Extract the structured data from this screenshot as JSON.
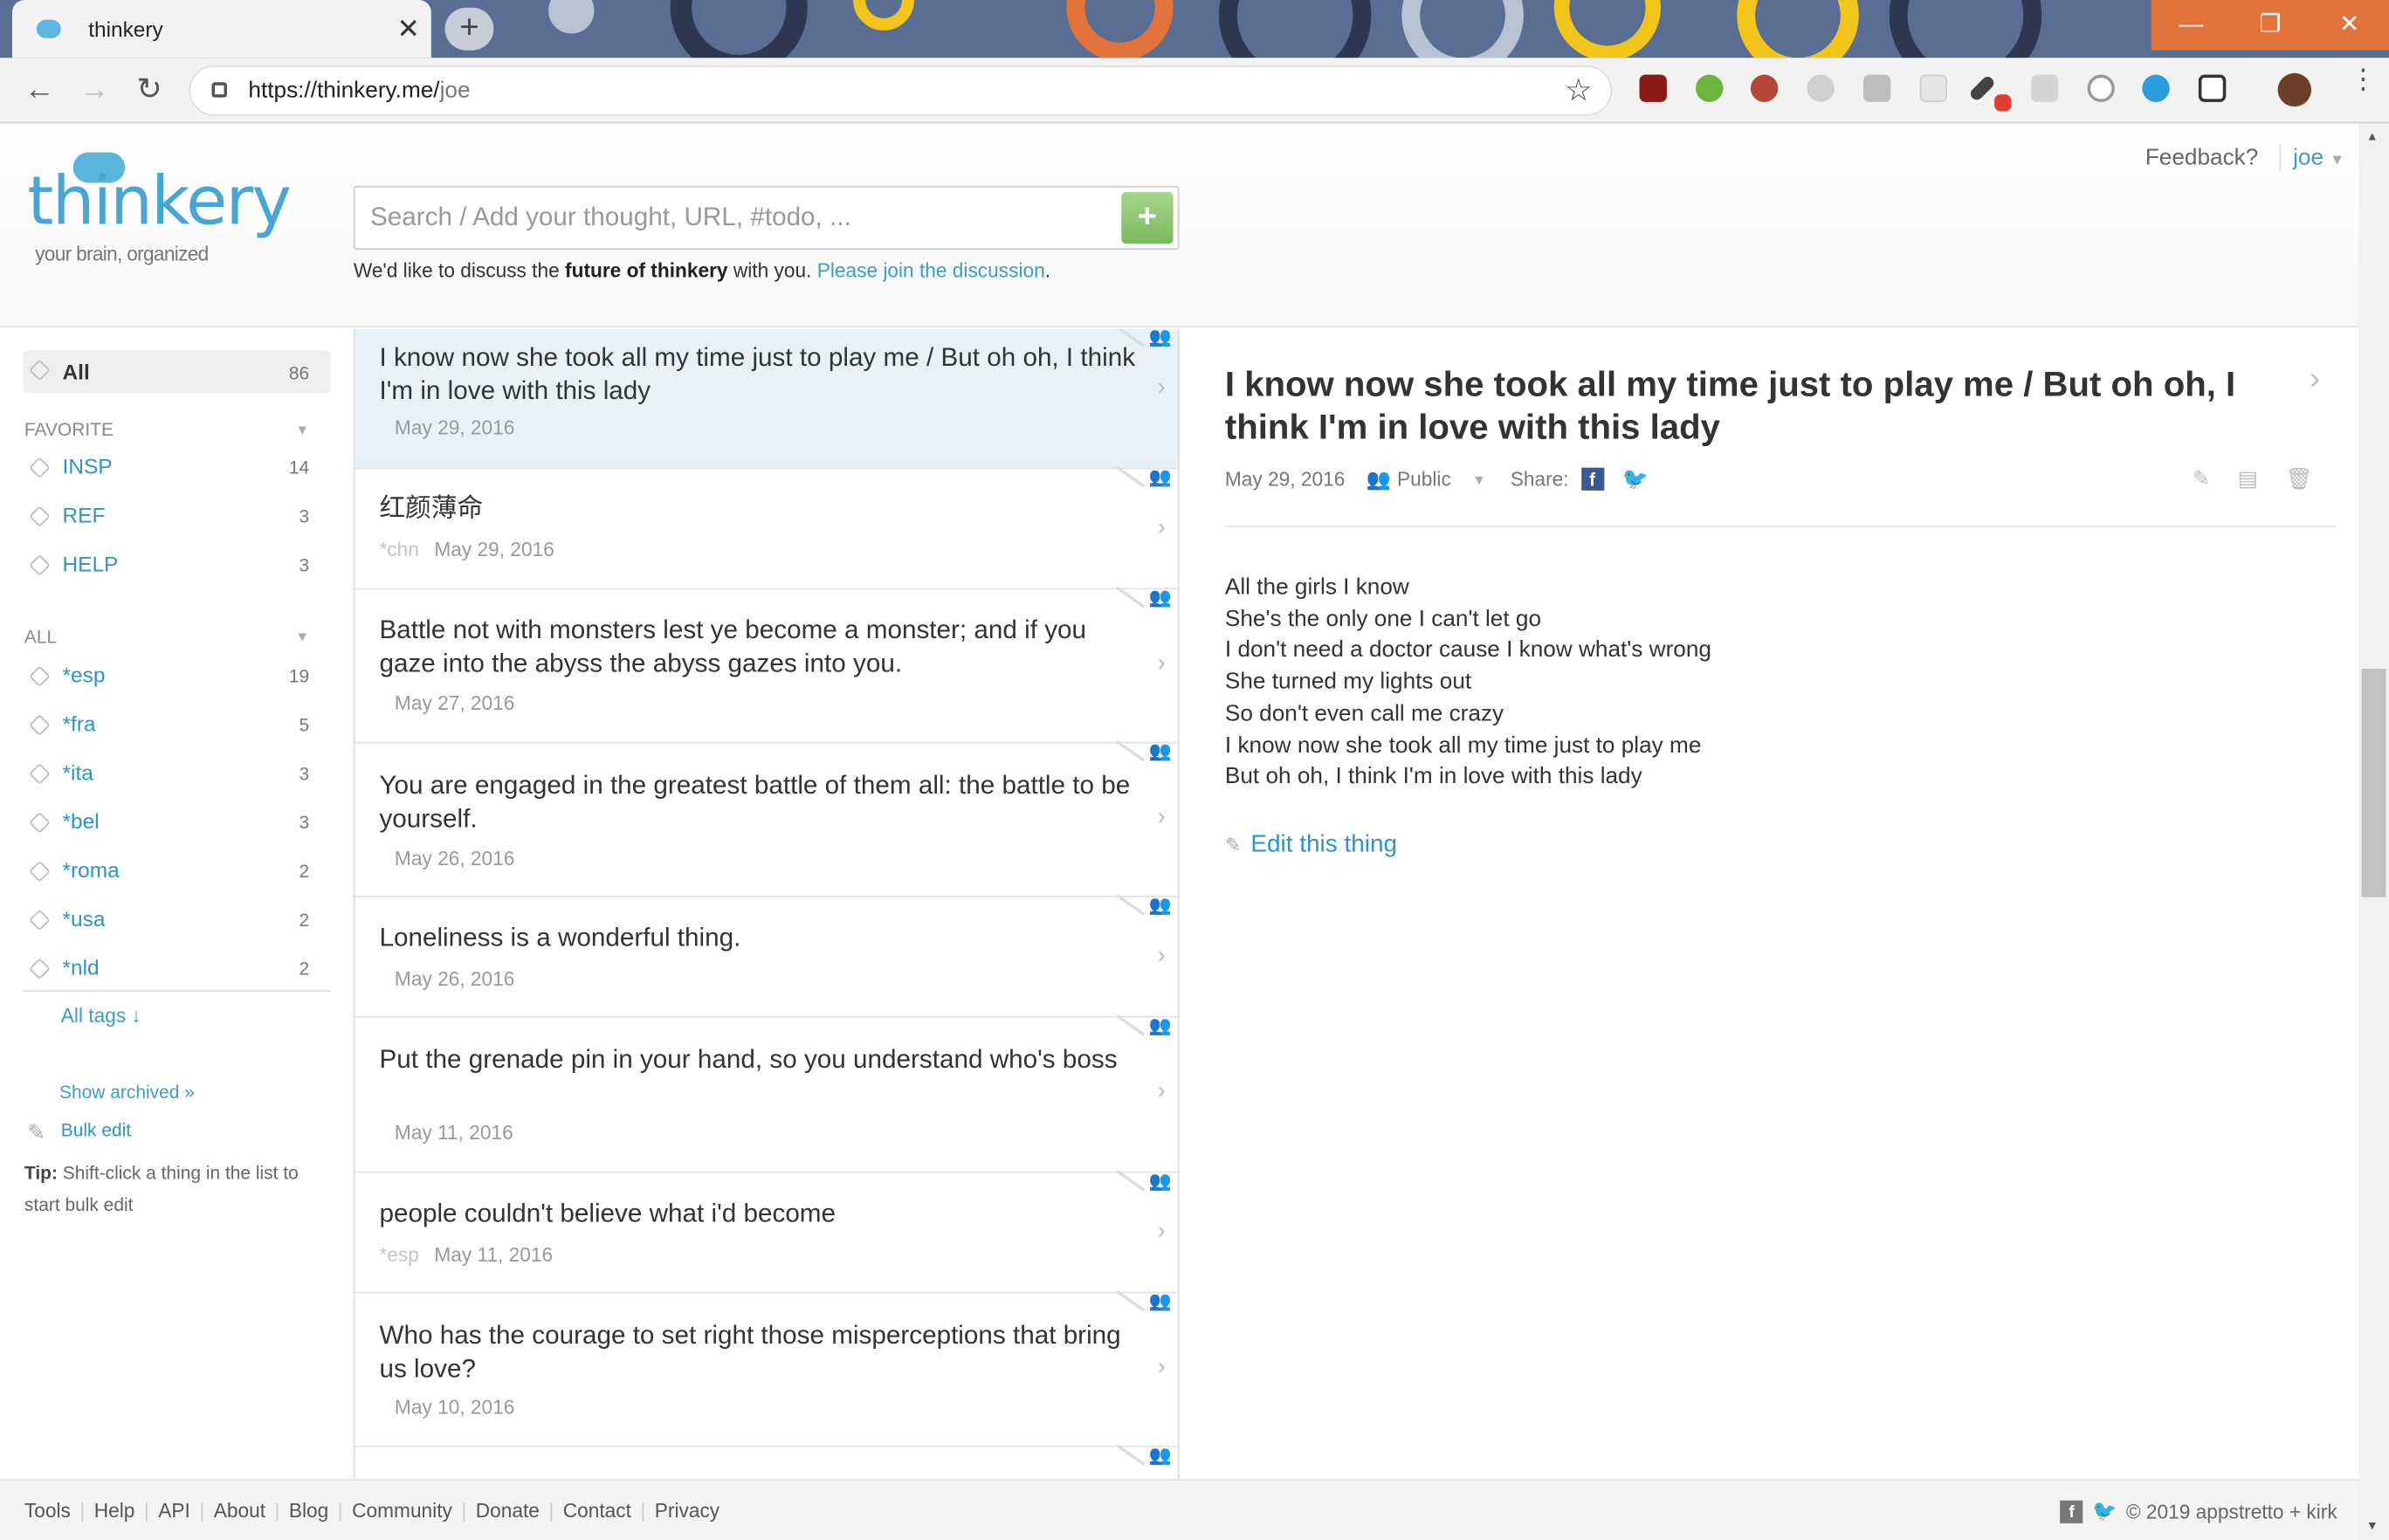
{
  "browser": {
    "tab_title": "thinkery",
    "tab_close": "✕",
    "new_tab": "+",
    "url_host": "https://thinkery.me/",
    "url_path": "joe",
    "window_controls": [
      "—",
      "❐",
      "✕"
    ]
  },
  "header": {
    "logo_word": "thinkery",
    "logo_tagline": "your brain, organized",
    "search_placeholder": "Search / Add your thought, URL, #todo, ...",
    "notice_pre": "We'd like to discuss the ",
    "notice_bold": "future of thinkery",
    "notice_mid": " with you. ",
    "notice_link": "Please join the discussion",
    "notice_end": ".",
    "feedback": "Feedback?",
    "user": "joe"
  },
  "sidebar": {
    "all": {
      "label": "All",
      "count": "86"
    },
    "favorite_heading": "FAVORITE",
    "favorites": [
      {
        "label": "INSP",
        "count": "14"
      },
      {
        "label": "REF",
        "count": "3"
      },
      {
        "label": "HELP",
        "count": "3"
      }
    ],
    "all_heading": "ALL",
    "tags": [
      {
        "label": "*esp",
        "count": "19"
      },
      {
        "label": "*fra",
        "count": "5"
      },
      {
        "label": "*ita",
        "count": "3"
      },
      {
        "label": "*bel",
        "count": "3"
      },
      {
        "label": "*roma",
        "count": "2"
      },
      {
        "label": "*usa",
        "count": "2"
      },
      {
        "label": "*nld",
        "count": "2"
      }
    ],
    "all_tags": "All tags ↓",
    "show_archived": "Show archived »",
    "bulk_edit": "Bulk edit",
    "tip_label": "Tip:",
    "tip_text": " Shift-click a thing in the list to start bulk edit"
  },
  "list": [
    {
      "title": "I know now she took all my time just to play me / But oh oh, I think I'm in love with this lady",
      "tag": "",
      "date": "May 29, 2016"
    },
    {
      "title": "红颜薄命",
      "tag": "*chn",
      "date": "May 29, 2016"
    },
    {
      "title": "Battle not with monsters lest ye become a monster; and if you gaze into the abyss the abyss gazes into you.",
      "tag": "",
      "date": "May 27, 2016"
    },
    {
      "title": "You are engaged in the greatest battle of them all: the battle to be yourself.",
      "tag": "",
      "date": "May 26, 2016"
    },
    {
      "title": "Loneliness is a wonderful thing.",
      "tag": "",
      "date": "May 26, 2016"
    },
    {
      "title": "Put the grenade pin in your hand, so you understand who's boss",
      "tag": "",
      "date": "May 11, 2016"
    },
    {
      "title": "people couldn't believe what i'd become",
      "tag": "*esp",
      "date": "May 11, 2016"
    },
    {
      "title": "Who has the courage to set right those misperceptions that bring us love?",
      "tag": "",
      "date": "May 10, 2016"
    }
  ],
  "detail": {
    "title": "I know now she took all my time just to play me / But oh oh, I think I'm in love with this lady",
    "date": "May 29, 2016",
    "visibility": "Public",
    "share_label": "Share:",
    "body": [
      "All the girls I know",
      "She's the only one I can't let go",
      "I don't need a doctor cause I know what's wrong",
      "She turned my lights out",
      "So don't even call me crazy",
      "I know now she took all my time just to play me",
      "But oh oh, I think I'm in love with this lady"
    ],
    "edit_link": "Edit this thing"
  },
  "footer": {
    "links": [
      "Tools",
      "Help",
      "API",
      "About",
      "Blog",
      "Community",
      "Donate",
      "Contact",
      "Privacy"
    ],
    "copyright": "© 2019 appstretto + kirk"
  },
  "colors": {
    "accent": "#3a9ccf",
    "selected_row": "#e8f1f8",
    "tabbar": "#5a6e93",
    "window_controls": "#e2733a"
  }
}
